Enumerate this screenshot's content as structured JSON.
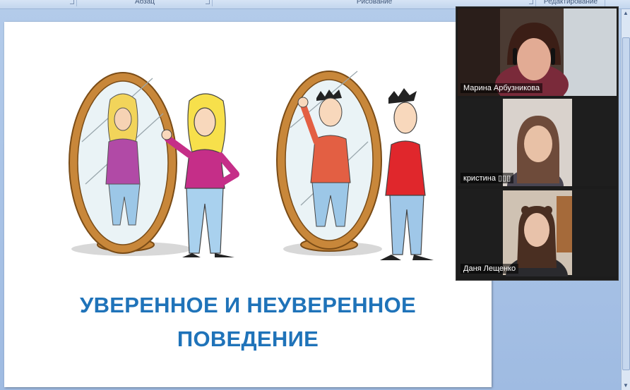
{
  "ribbon": {
    "groups": [
      {
        "label": ""
      },
      {
        "label": "Абзац"
      },
      {
        "label": "Рисование"
      },
      {
        "label": "Редактирование"
      }
    ]
  },
  "slide": {
    "title_line1": "УВЕРЕННОЕ И НЕУВЕРЕННОЕ",
    "title_line2": "ПОВЕДЕНИЕ"
  },
  "video": {
    "participants": [
      {
        "name": "Марина Арбузникова",
        "active": false
      },
      {
        "name": "кристина ▯▯▯",
        "active": false
      },
      {
        "name": "Даня Лещенко",
        "active": true
      }
    ]
  },
  "colors": {
    "title": "#1f73b9",
    "active_speaker": "#23d959",
    "mirror_frame": "#c8873a"
  }
}
